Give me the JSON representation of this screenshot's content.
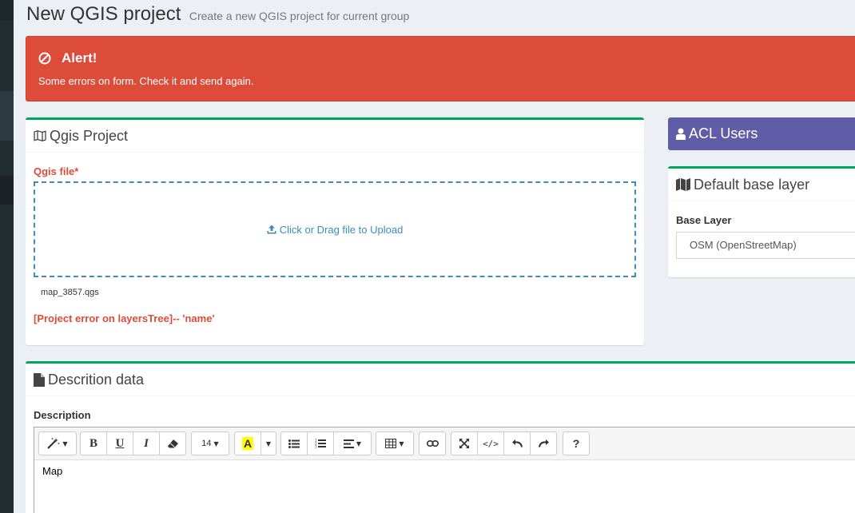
{
  "header": {
    "title": "New QGIS project",
    "subtitle": "Create a new QGIS project for current group"
  },
  "alert": {
    "title": "Alert!",
    "message": "Some errors on form. Check it and send again.",
    "color": "#dd4b39"
  },
  "qgis_project": {
    "title": "Qgis Project",
    "file_label": "Qgis file*",
    "upload_text": "Click or Drag file to Upload",
    "filename": "map_3857.qgs",
    "error": "[Project error on layersTree]-- 'name'"
  },
  "acl_users": {
    "title": "ACL Users",
    "color": "#605ca8"
  },
  "base_layer": {
    "title": "Default base layer",
    "label": "Base Layer",
    "selected": "OSM (OpenStreetMap)"
  },
  "description": {
    "title": "Descrition data",
    "label": "Description",
    "content": "Map",
    "toolbar": {
      "font_size": "14",
      "bold": "B",
      "underline": "U",
      "italic": "I",
      "font_color": "A",
      "help": "?",
      "code": "</>"
    }
  },
  "colors": {
    "accent_green": "#00a65a",
    "link_blue": "#3c8dbc",
    "sidebar": "#222d32"
  }
}
